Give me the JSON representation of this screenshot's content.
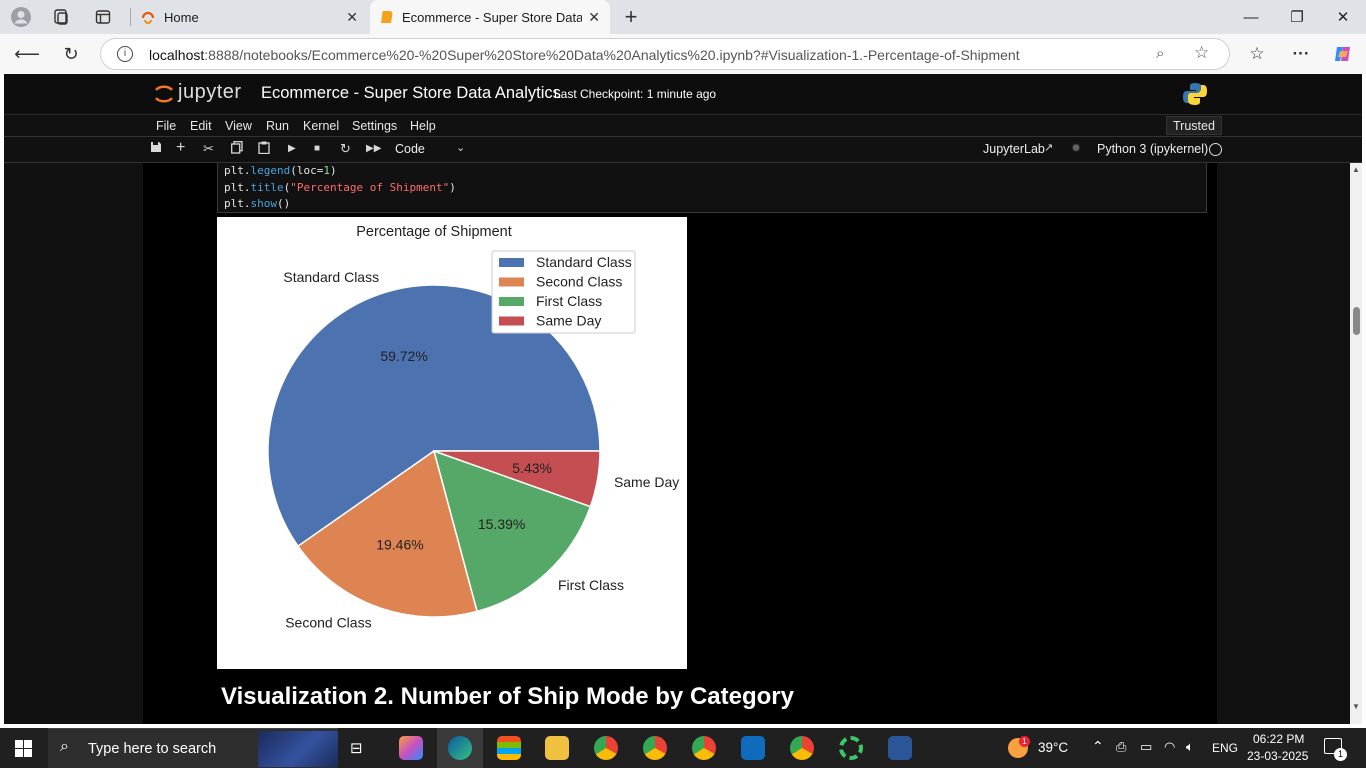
{
  "browser": {
    "tabs": [
      {
        "label": "Home",
        "active": false
      },
      {
        "label": "Ecommerce - Super Store Data Ar",
        "active": true
      }
    ],
    "url_host": "localhost",
    "url_rest": ":8888/notebooks/Ecommerce%20-%20Super%20Store%20Data%20Analytics%20.ipynb?#Visualization-1.-Percentage-of-Shipment",
    "icons": [
      "profile-icon",
      "workspaces-icon",
      "tab-actions-icon",
      "new-tab-icon",
      "back-icon",
      "refresh-icon",
      "info-icon",
      "zoom-icon",
      "favorite-icon",
      "favorites-icon",
      "more-icon",
      "copilot-icon"
    ]
  },
  "jupyter": {
    "logo": "jupyter",
    "title": "Ecommerce - Super Store Data Analytics",
    "checkpoint": "Last Checkpoint: 1 minute ago",
    "trusted": "Trusted",
    "menu": [
      "File",
      "Edit",
      "View",
      "Run",
      "Kernel",
      "Settings",
      "Help"
    ],
    "cell_type": "Code",
    "jupyterlab": "JupyterLab",
    "kernel": "Python 3 (ipykernel)",
    "code_lines": [
      {
        "a": "plt.",
        "b": "legend",
        "c": "(loc=",
        "d": "1",
        "e": ")"
      },
      {
        "a": "plt.",
        "b": "title",
        "c": "(",
        "d": "\"Percentage of Shipment\"",
        "e": ")"
      },
      {
        "a": "plt.",
        "b": "show",
        "c": "()",
        "d": "",
        "e": ""
      }
    ],
    "markdown_heading": "Visualization 2. Number of Ship Mode by Category"
  },
  "chart_data": {
    "type": "pie",
    "title": "Percentage of Shipment",
    "categories": [
      "Standard Class",
      "Second Class",
      "First Class",
      "Same Day"
    ],
    "values": [
      59.72,
      19.46,
      15.39,
      5.43
    ],
    "labels_pct": [
      "59.72%",
      "19.46%",
      "15.39%",
      "5.43%"
    ],
    "colors": [
      "#4c72b0",
      "#dd8452",
      "#55a868",
      "#c44e52"
    ],
    "legend": [
      "Standard Class",
      "Second Class",
      "First Class",
      "Same Day"
    ],
    "legend_position": "top-right"
  },
  "taskbar": {
    "search_placeholder": "Type here to search",
    "weather": "39°C",
    "weather_badge": "1",
    "language": "ENG",
    "time": "06:22 PM",
    "date": "23-03-2025",
    "notification_count": "1"
  }
}
